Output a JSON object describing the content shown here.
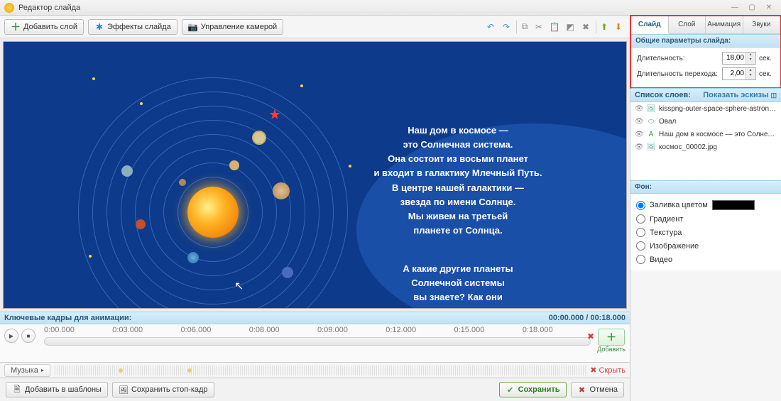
{
  "window": {
    "title": "Редактор слайда"
  },
  "toolbar": {
    "add_layer": "Добавить слой",
    "effects": "Эффекты слайда",
    "camera": "Управление камерой"
  },
  "slide_text_1": "Наш дом в космосе —\nэто Солнечная система.\nОна состоит из восьми планет\nи входит в галактику Млечный Путь.\nВ центре нашей галактики —\nзвезда по имени Солнце.\nМы живем на третьей\nпланете от Солнца.",
  "slide_text_2": "А какие другие планеты\nСолнечной системы\nвы знаете? Как они\nназываются?",
  "timeline": {
    "header": "Ключевые кадры для анимации:",
    "time": "00:00.000 / 00:18.000",
    "ticks": [
      "0:00.000",
      "0:03.000",
      "0:06.000",
      "0:08.000",
      "0:09.000",
      "0:12.000",
      "0:15.000",
      "0:18.000"
    ],
    "add": "Добавить",
    "music": "Музыка",
    "hide": "Скрыть"
  },
  "bottom": {
    "add_template": "Добавить в шаблоны",
    "save_frame": "Сохранить стоп-кадр",
    "save": "Сохранить",
    "cancel": "Отмена"
  },
  "panel": {
    "tabs": [
      "Слайд",
      "Слой",
      "Анимация",
      "Звуки"
    ],
    "active_tab": 0,
    "general_header": "Общие параметры слайда:",
    "duration_label": "Длительность:",
    "duration_value": "18,00",
    "transition_label": "Длительность перехода:",
    "transition_value": "2,00",
    "unit": "сек.",
    "layers_header": "Список слоев:",
    "show_thumbs": "Показать эскизы",
    "layers": [
      {
        "icon": "image",
        "name": "kisspng-outer-space-sphere-astronomi..."
      },
      {
        "icon": "oval",
        "name": "Овал"
      },
      {
        "icon": "text",
        "name": "Наш дом в космосе —   это Солнечная..."
      },
      {
        "icon": "image",
        "name": "космос_00002.jpg"
      }
    ],
    "bg_header": "Фон:",
    "bg_options": [
      "Заливка цветом",
      "Градиент",
      "Текстура",
      "Изображение",
      "Видео"
    ],
    "bg_selected": 0
  }
}
